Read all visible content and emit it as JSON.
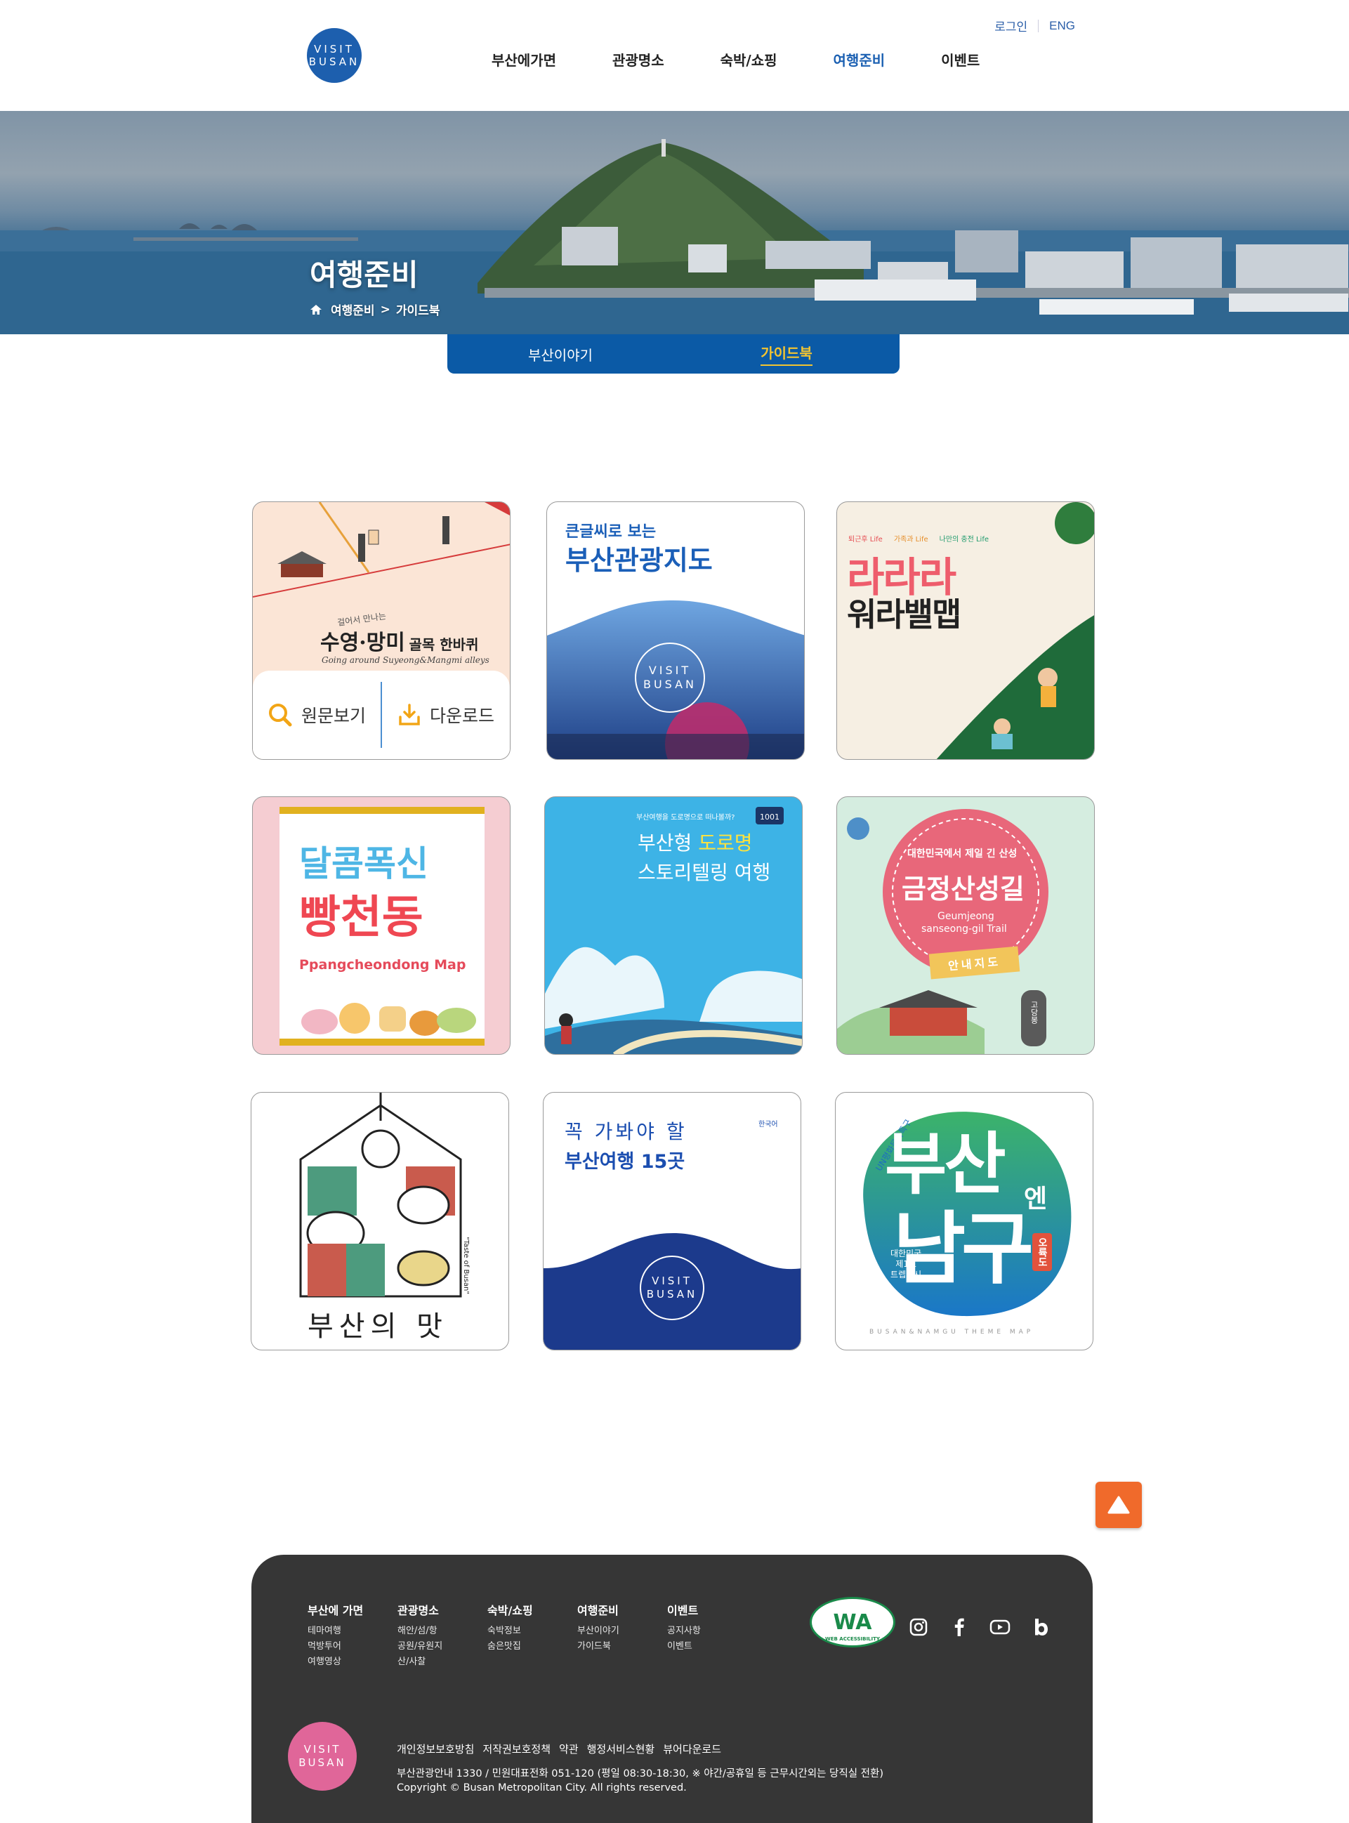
{
  "header": {
    "logo": [
      "VISIT",
      "BUSAN"
    ],
    "util": {
      "login": "로그인",
      "lang": "ENG"
    },
    "nav": [
      "부산에가면",
      "관광명소",
      "숙박/쇼핑",
      "여행준비",
      "이벤트"
    ]
  },
  "hero": {
    "title": "여행준비",
    "breadcrumb": [
      "여행준비",
      ">",
      "가이드북"
    ]
  },
  "tabs": [
    "부산이야기",
    "가이드북"
  ],
  "cards": {
    "c1": {
      "script": "걸어서 만나는",
      "title": "수영·망미",
      "title_small": "골목 한바퀴",
      "sub": "Going around Suyeong&Mangmi alleys",
      "view": "원문보기",
      "download": "다운로드"
    },
    "c2": {
      "line1": "큰글씨로 보는",
      "line2": "부산관광지도",
      "logo": [
        "VISIT",
        "BUSAN"
      ]
    },
    "c3": {
      "tags": [
        "퇴근후 Life",
        "가족과 Life",
        "나만의 충전 Life"
      ],
      "line1": "라라라",
      "line2": "워라밸맵"
    },
    "c4": {
      "line1": "달콤폭신",
      "line2": "빵천동",
      "sub": "Ppangcheondong Map"
    },
    "c5": {
      "small": "부산여행을 도로명으로 떠나볼까?",
      "line1a": "부산형 ",
      "line1b": "도로명",
      "line2": "스토리텔링 여행",
      "badge": "1001"
    },
    "c6": {
      "top": "대한민국에서 제일 긴 산성",
      "title": "금정산성길",
      "en1": "Geumjeong",
      "en2": "sanseong-gil Trail",
      "ribbon": "안내지도",
      "stone": "고당봉"
    },
    "c7": {
      "title": "부산의 맛",
      "side": "\"Taste of Busan\""
    },
    "c8": {
      "line1": "꼭 가봐야 할",
      "line2": "부산여행 15곳",
      "lang": "한국어",
      "logo": [
        "VISIT",
        "BUSAN"
      ]
    },
    "c9": {
      "arc": "UN평화문화특구",
      "big1": "부산",
      "small": "엔",
      "big2": "남구",
      "tag": "오륙도",
      "note": [
        "대한민국",
        "제1호",
        "트렙도시"
      ],
      "bottom": "BUSAN&NAMGU THEME MAP"
    }
  },
  "footer": {
    "cols": [
      {
        "h": "부산에 가면",
        "items": [
          "테마여행",
          "먹방투어",
          "여행영상"
        ]
      },
      {
        "h": "관광명소",
        "items": [
          "해안/섬/항",
          "공원/유원지",
          "산/사찰"
        ]
      },
      {
        "h": "숙박/쇼핑",
        "items": [
          "숙박정보",
          "숨은맛집"
        ]
      },
      {
        "h": "여행준비",
        "items": [
          "부산이야기",
          "가이드북"
        ]
      },
      {
        "h": "이벤트",
        "items": [
          "공지사항",
          "이벤트"
        ]
      }
    ],
    "wa": "WA",
    "wa_caption": "WEB ACCESSIBILITY",
    "logo": [
      "VISIT",
      "BUSAN"
    ],
    "links": [
      "개인정보보호방침",
      "저작권보호정책",
      "약관",
      "행정서비스현황",
      "뷰어다운로드"
    ],
    "info": "부산관광안내 1330 / 민원대표전화 051-120 (평일 08:30-18:30, ※ 야간/공휴일 등 근무시간외는 당직실 전환)",
    "copyright": "Copyright © Busan Metropolitan City. All rights reserved."
  },
  "colors": {
    "brand": "#1d5fae",
    "tab_bg": "#0b5aa6",
    "tab_active": "#f3c431",
    "top_button": "#f06a2b",
    "footer_bg": "#363636"
  }
}
